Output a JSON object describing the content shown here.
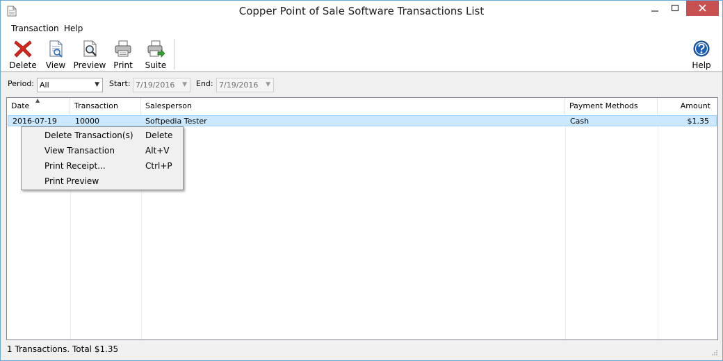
{
  "window": {
    "title": "Copper Point of Sale Software Transactions List"
  },
  "menubar": {
    "items": [
      {
        "label": "Transaction"
      },
      {
        "label": "Help"
      }
    ]
  },
  "toolbar": {
    "buttons": [
      {
        "label": "Delete",
        "icon": "delete-x-icon"
      },
      {
        "label": "View",
        "icon": "view-document-icon"
      },
      {
        "label": "Preview",
        "icon": "magnifier-document-icon"
      },
      {
        "label": "Print",
        "icon": "printer-icon"
      },
      {
        "label": "Suite",
        "icon": "suite-arrow-icon"
      },
      {
        "label": "Help",
        "icon": "help-question-icon"
      }
    ]
  },
  "filters": {
    "period_label": "Period:",
    "period_value": "All",
    "start_label": "Start:",
    "start_value": "7/19/2016",
    "end_label": "End:",
    "end_value": "7/19/2016"
  },
  "list": {
    "columns": [
      "Date",
      "Transaction",
      "Salesperson",
      "Payment Methods",
      "Amount"
    ],
    "rows": [
      {
        "date": "2016-07-19",
        "transaction": "10000",
        "salesperson": "Softpedia Tester",
        "payment": "Cash",
        "amount": "$1.35"
      }
    ]
  },
  "context_menu": {
    "items": [
      {
        "label": "Delete Transaction(s)",
        "shortcut": "Delete"
      },
      {
        "label": "View Transaction",
        "shortcut": "Alt+V"
      },
      {
        "label": "Print Receipt...",
        "shortcut": "Ctrl+P"
      },
      {
        "label": "Print Preview",
        "shortcut": ""
      }
    ]
  },
  "status": {
    "text": "1 Transactions. Total $1.35"
  },
  "colors": {
    "selection_bg": "#cce8ff",
    "close_button": "#c75050",
    "window_border": "#6aa9d6"
  }
}
